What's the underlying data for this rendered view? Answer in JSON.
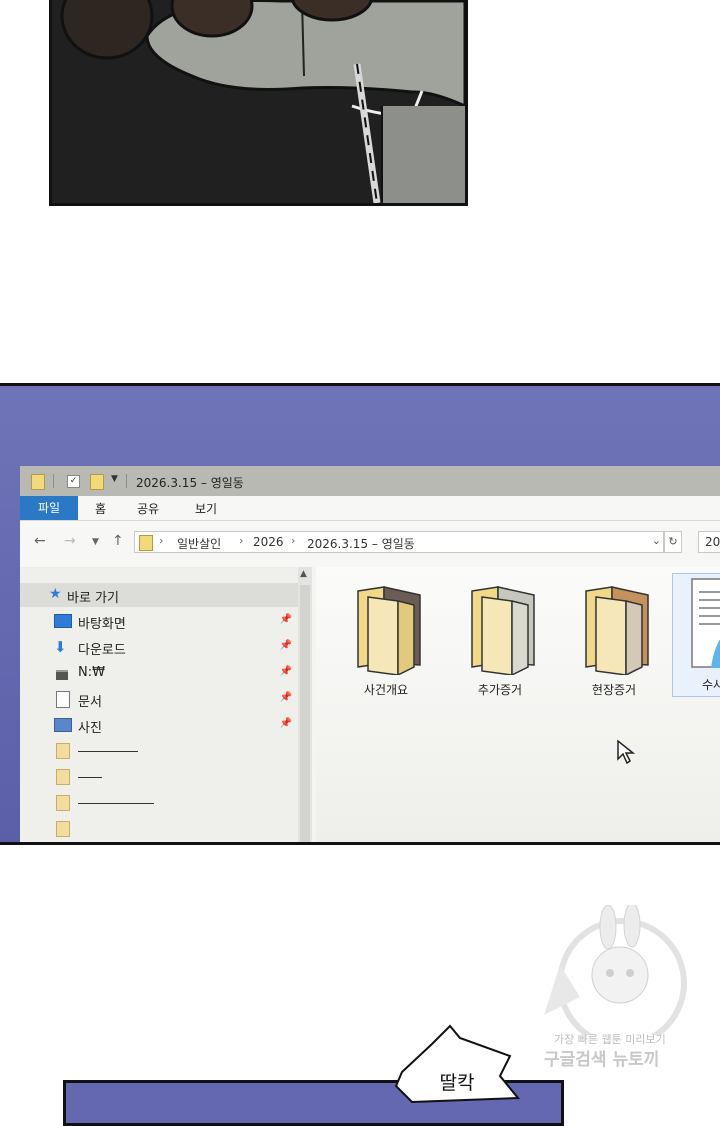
{
  "explorer": {
    "title": "2026.3.15 – 영일동",
    "ribbon_tabs": [
      "파일",
      "홈",
      "공유",
      "보기"
    ],
    "breadcrumb": [
      "일반살인",
      "2026",
      "2026.3.15 – 영일동"
    ],
    "search_text": "20",
    "nav_pane": {
      "quick_access": "바로 가기",
      "items": [
        "바탕화면",
        "다운로드",
        "N:₩",
        "문서",
        "사진"
      ]
    },
    "folders": [
      "사건개요",
      "추가증거",
      "현장증거"
    ],
    "file_partial": "수사"
  },
  "watermark": {
    "line1": "가장 빠른 웹툰 미리보기",
    "line2": "구글검색 뉴토끼"
  },
  "sfx": "딸칵",
  "colors": {
    "ribbon_file_tab": "#2b78c4",
    "folder_yellow": "#f1d97c",
    "screen_bg": "#6468b0"
  }
}
